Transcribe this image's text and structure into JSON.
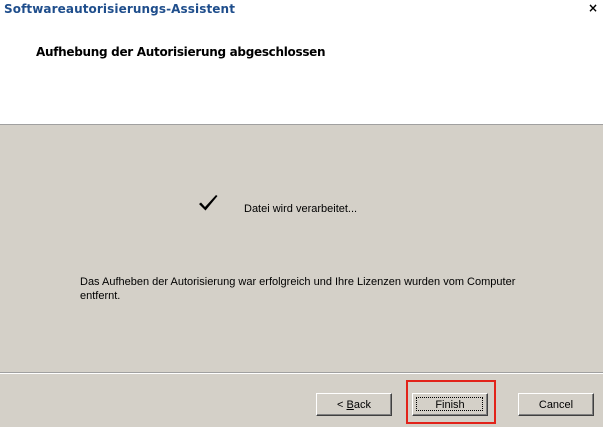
{
  "window": {
    "title": "Softwareautorisierungs-Assistent",
    "close_glyph": "×",
    "close_icon": "close-icon"
  },
  "header": {
    "title": "Aufhebung der Autorisierung abgeschlossen"
  },
  "content": {
    "check_icon": "checkmark-icon",
    "status": "Datei wird verarbeitet...",
    "message": "Das Aufheben der Autorisierung war erfolgreich und Ihre Lizenzen wurden vom Computer entfernt."
  },
  "buttons": {
    "back_prefix": "< ",
    "back_mnemonic": "B",
    "back_rest": "ack",
    "finish": "Finish",
    "cancel": "Cancel"
  },
  "colors": {
    "title_text": "#1f4e8c",
    "highlight": "#e2231a",
    "dialog_bg": "#d4d0c8"
  }
}
